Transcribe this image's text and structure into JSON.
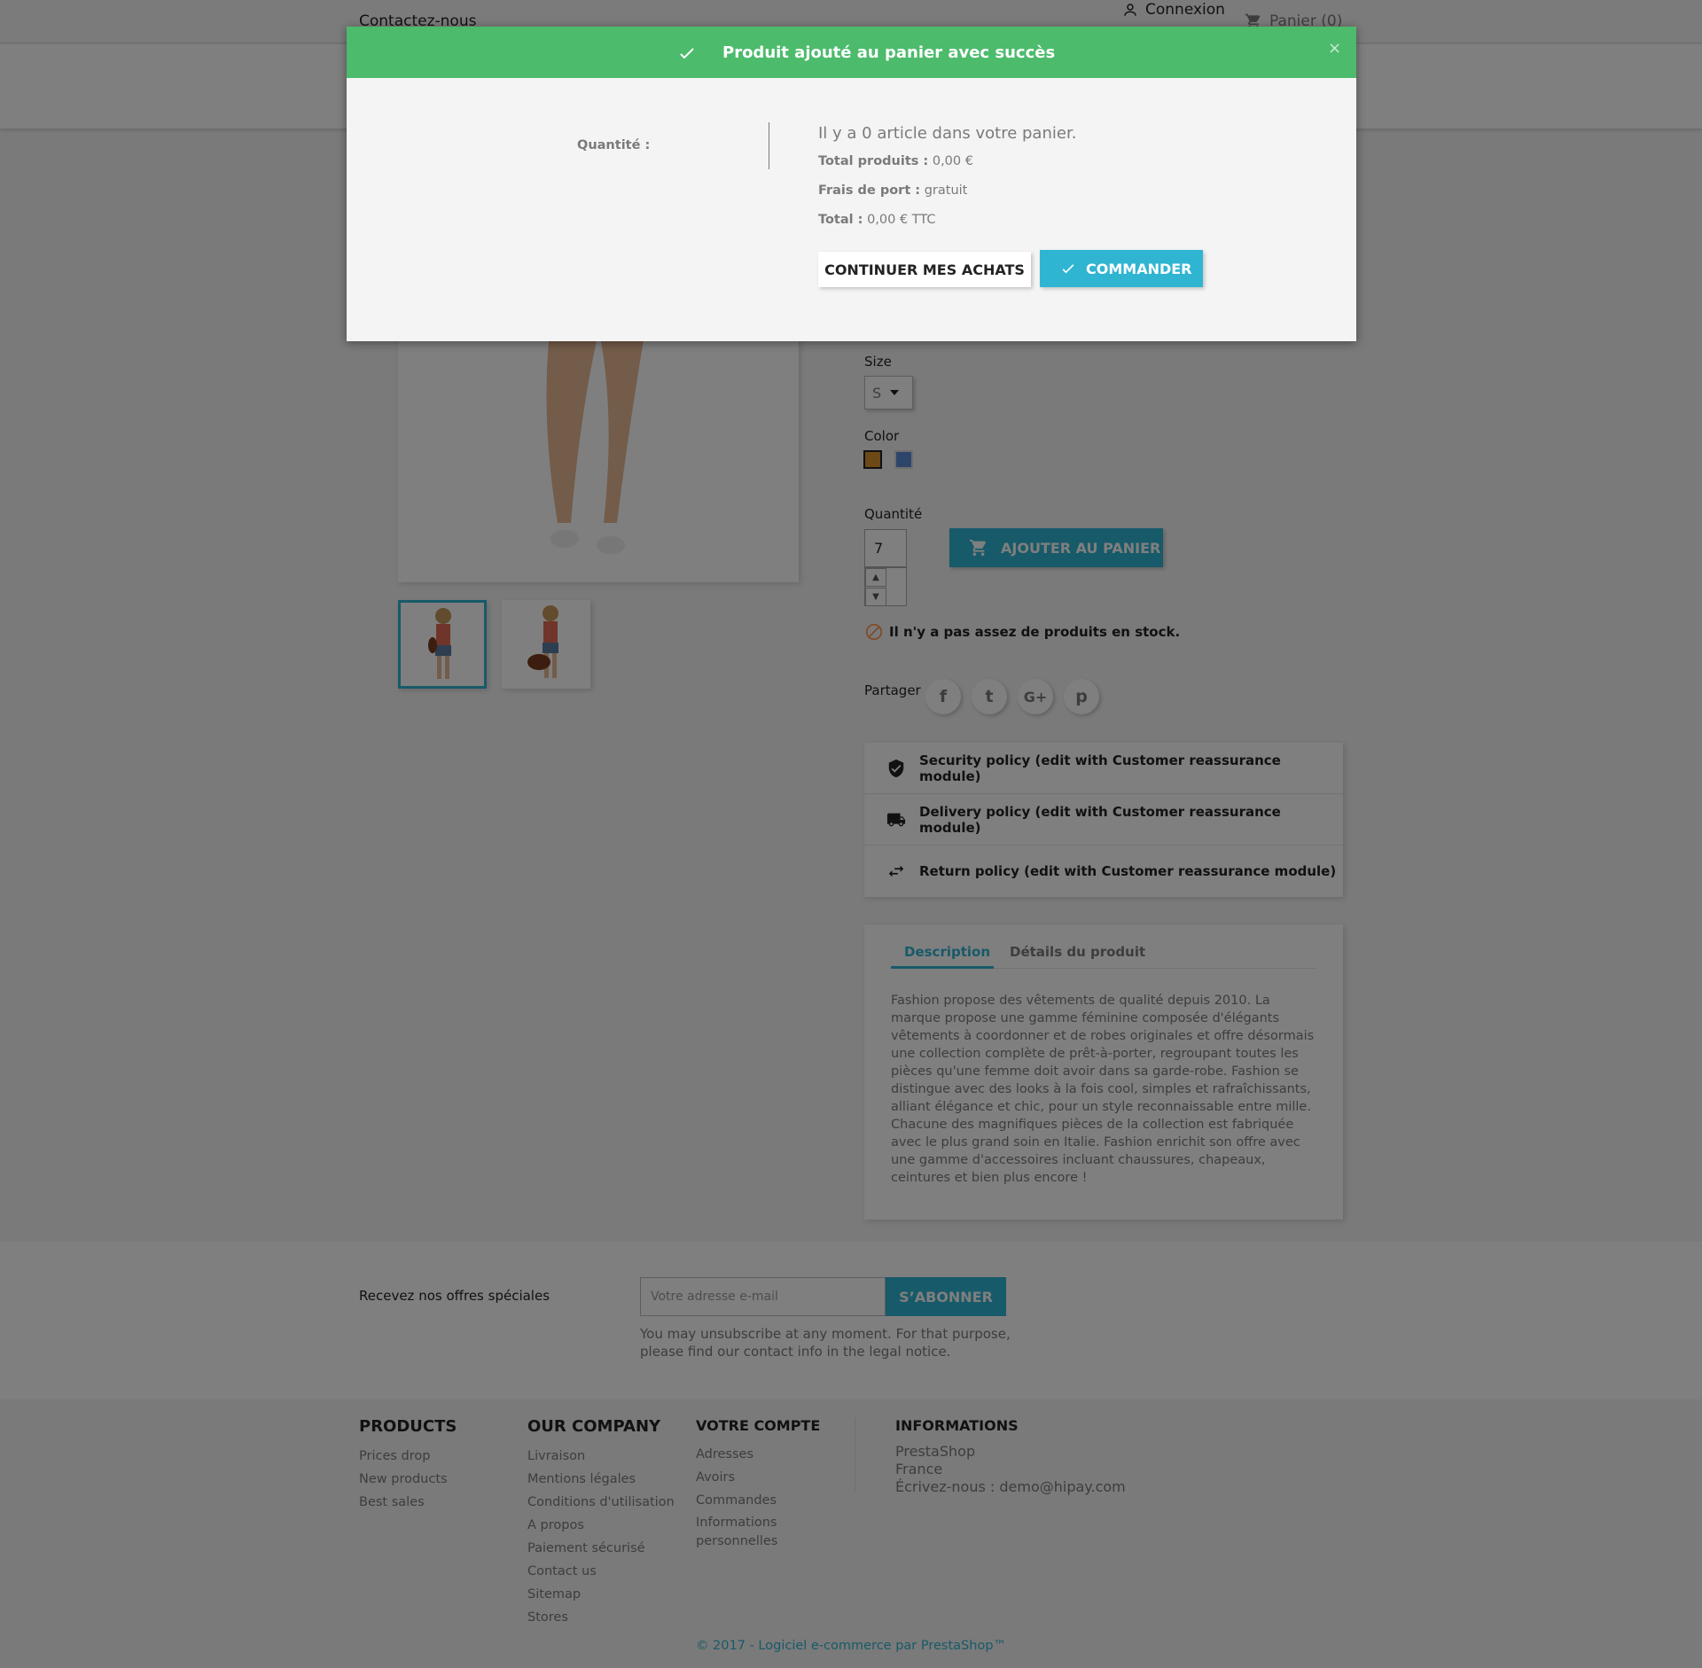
{
  "header": {
    "contact": "Contactez-nous",
    "login": "Connexion",
    "cart": "Panier (0)"
  },
  "product": {
    "size_label": "Size",
    "size_value": "S",
    "color_label": "Color",
    "colors": [
      "#d9932c",
      "#5b8ad6"
    ],
    "quantity_label": "Quantité",
    "quantity_value": "7",
    "add_to_cart": "Ajouter au panier",
    "stock_alert": "Il n'y a pas assez de produits en stock.",
    "share_label": "Partager",
    "share": {
      "facebook": "f",
      "twitter": "t",
      "googleplus": "G+",
      "pinterest": "p"
    }
  },
  "reassurance": [
    "Security policy (edit with Customer reassurance module)",
    "Delivery policy (edit with Customer reassurance module)",
    "Return policy (edit with Customer reassurance module)"
  ],
  "tabs": {
    "description": "Description",
    "details": "Détails du produit",
    "description_text": "Fashion propose des vêtements de qualité depuis 2010. La marque propose une gamme féminine composée d'élégants vêtements à coordonner et de robes originales et offre désormais une collection complète de prêt-à-porter, regroupant toutes les pièces qu'une femme doit avoir dans sa garde-robe. Fashion se distingue avec des looks à la fois cool, simples et rafraîchissants, alliant élégance et chic, pour un style reconnaissable entre mille. Chacune des magnifiques pièces de la collection est fabriquée avec le plus grand soin en Italie. Fashion enrichit son offre avec une gamme d'accessoires incluant chaussures, chapeaux, ceintures et bien plus encore !"
  },
  "newsletter": {
    "label": "Recevez nos offres spéciales",
    "placeholder": "Votre adresse e-mail",
    "button": "S’ABONNER",
    "note": "You may unsubscribe at any moment. For that purpose, please find our contact info in the legal notice."
  },
  "footer": {
    "products": {
      "title": "PRODUCTS",
      "links": [
        "Prices drop",
        "New products",
        "Best sales"
      ]
    },
    "company": {
      "title": "OUR COMPANY",
      "links": [
        "Livraison",
        "Mentions légales",
        "Conditions d'utilisation",
        "A propos",
        "Paiement sécurisé",
        "Contact us",
        "Sitemap",
        "Stores"
      ]
    },
    "account": {
      "title": "VOTRE COMPTE",
      "links": [
        "Adresses",
        "Avoirs",
        "Commandes",
        "Informations personnelles"
      ]
    },
    "info": {
      "title": "INFORMATIONS",
      "lines": [
        "PrestaShop",
        "France",
        "Écrivez-nous : demo@hipay.com"
      ]
    },
    "copyright": "© 2017 - Logiciel e-commerce par PrestaShop™"
  },
  "modal": {
    "title": "Produit ajouté au panier avec succès",
    "close": "×",
    "quantity_label": "Quantité :",
    "cart_count": "Il y a 0 article dans votre panier.",
    "total_products_label": "Total produits :",
    "total_products_value": "0,00 €",
    "shipping_label": "Frais de port :",
    "shipping_value": "gratuit",
    "total_label": "Total :",
    "total_value": "0,00 € TTC",
    "continue": "CONTINUER MES ACHATS",
    "order": "COMMANDER"
  },
  "colors": {
    "accent": "#2fb5d2",
    "success": "#4cbb6c",
    "stock_alert": "#ff9a52"
  }
}
